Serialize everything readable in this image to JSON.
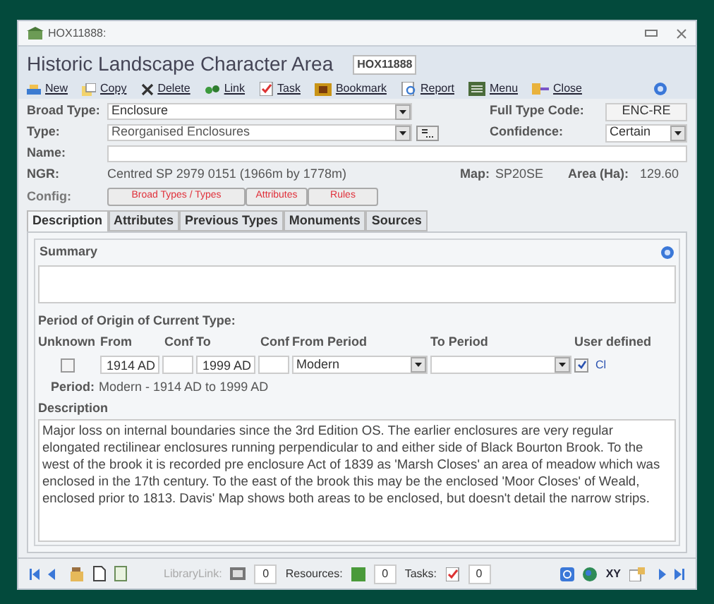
{
  "window": {
    "title": "HOX11888:"
  },
  "header": {
    "title": "Historic Landscape Character Area",
    "record_id": "HOX11888"
  },
  "toolbar": [
    {
      "label": "New",
      "kind": "new"
    },
    {
      "label": "Copy",
      "kind": "copy"
    },
    {
      "label": "Delete",
      "kind": "delete"
    },
    {
      "label": "Link",
      "kind": "link"
    },
    {
      "label": "Task",
      "kind": "task"
    },
    {
      "label": "Bookmark",
      "kind": "bookmark"
    },
    {
      "label": "Report",
      "kind": "report"
    },
    {
      "label": "Menu",
      "kind": "menu"
    },
    {
      "label": "Close",
      "kind": "close"
    }
  ],
  "fields": {
    "broad_type": {
      "label": "Broad Type:",
      "value": "Enclosure"
    },
    "full_type_code": {
      "label": "Full Type Code:",
      "value": "ENC-RE"
    },
    "type": {
      "label": "Type:",
      "value": "Reorganised Enclosures"
    },
    "confidence": {
      "label": "Confidence:",
      "value": "Certain"
    },
    "name": {
      "label": "Name:"
    },
    "ngr": {
      "label": "NGR:",
      "value": "Centred SP 2979 0151 (1966m by 1778m)"
    },
    "map": {
      "label": "Map:",
      "value": "SP20SE"
    },
    "area": {
      "label": "Area (Ha):",
      "value": "129.60"
    },
    "config": {
      "label": "Config:",
      "buttons": [
        "Broad Types / Types",
        "Attributes",
        "Rules"
      ]
    }
  },
  "tabs": [
    {
      "label": "Description",
      "selected": true
    },
    {
      "label": "Attributes",
      "selected": false
    },
    {
      "label": "Previous Types",
      "selected": false
    },
    {
      "label": "Monuments",
      "selected": false
    },
    {
      "label": "Sources",
      "selected": false
    }
  ],
  "summary": {
    "label": "Summary"
  },
  "period": {
    "heading": "Period of Origin of Current Type:",
    "columns": [
      "Unknown",
      "From",
      "Conf",
      "To",
      "Conf",
      "From Period",
      "To Period",
      "User defined"
    ],
    "unknown_checked": false,
    "from": "1914 AD",
    "to": "1999 AD",
    "from_period": "Modern",
    "user_defined_checked": true,
    "user_defined_code": "Cl",
    "period_label": "Period:",
    "period_value": "Modern - 1914 AD to 1999 AD"
  },
  "description": {
    "label": "Description",
    "text": "Major loss on internal boundaries since the 3rd Edition OS. The earlier enclosures are very regular elongated rectilinear enclosures running perpendicular to and either side of Black Bourton Brook. To the west of the brook it is recorded pre enclosure Act of 1839 as 'Marsh Closes' an area of meadow which was enclosed in the 17th century. To the east of the brook this may be the enclosed 'Moor Closes' of Weald, enclosed prior to 1813. Davis' Map shows both areas to be enclosed, but doesn't detail the narrow strips."
  },
  "status_bar": {
    "library_link": {
      "label": "LibraryLink:",
      "count": "0"
    },
    "resources": {
      "label": "Resources:",
      "count": "0"
    },
    "tasks": {
      "label": "Tasks:",
      "count": "0"
    },
    "xy": "XY"
  }
}
